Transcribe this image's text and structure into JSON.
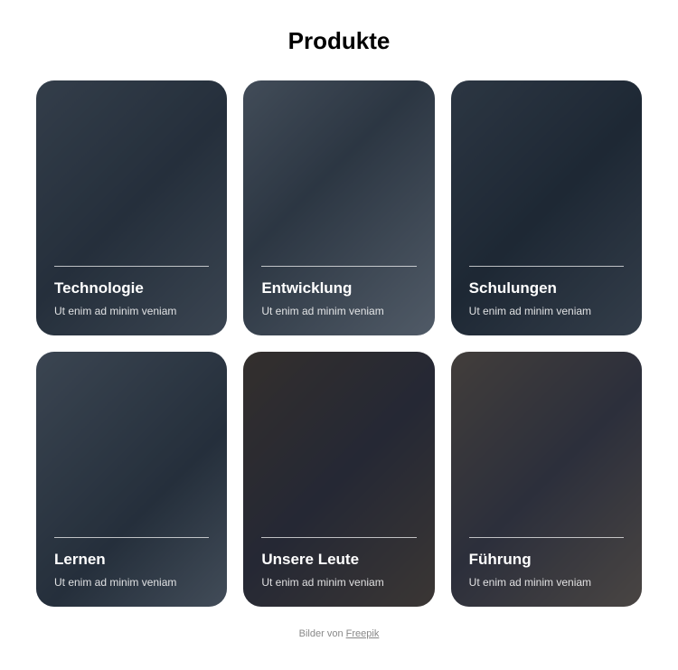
{
  "heading": "Produkte",
  "cards": [
    {
      "title": "Technologie",
      "subtitle": "Ut enim ad minim veniam"
    },
    {
      "title": "Entwicklung",
      "subtitle": "Ut enim ad minim veniam"
    },
    {
      "title": "Schulungen",
      "subtitle": "Ut enim ad minim veniam"
    },
    {
      "title": "Lernen",
      "subtitle": "Ut enim ad minim veniam"
    },
    {
      "title": "Unsere Leute",
      "subtitle": "Ut enim ad minim veniam"
    },
    {
      "title": "Führung",
      "subtitle": "Ut enim ad minim veniam"
    }
  ],
  "attribution": {
    "prefix": "Bilder von ",
    "link_text": "Freepik"
  }
}
